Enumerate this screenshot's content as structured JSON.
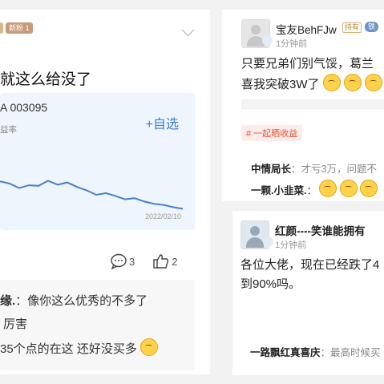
{
  "left_post": {
    "badge": "新粉 1",
    "title": "就这么给没了",
    "fund": {
      "code": "A 003095",
      "sub_label": "益率",
      "add_label": "+自选",
      "date": "2022/02/10"
    },
    "comment_count": "3",
    "like_count": "2",
    "comments": [
      {
        "name": "缘.",
        "text": "：像你这么优秀的不多了"
      },
      {
        "name": "",
        "text": "厉害"
      },
      {
        "name": "",
        "text": "35个点的在这 还好没买多"
      }
    ],
    "chart_data": {
      "type": "line",
      "series": [
        {
          "values": [
            0.54,
            0.5,
            0.42,
            0.47,
            0.46,
            0.55,
            0.48,
            0.52,
            0.44,
            0.38,
            0.3,
            0.33,
            0.28,
            0.22,
            0.24,
            0.18,
            0.14,
            0.12,
            0.08,
            0.05
          ]
        }
      ],
      "x_end_label": "2022/02/10",
      "note": "relative fund return trend (values read as normalized levels)"
    }
  },
  "right_post_1": {
    "username": "宝友BehFJw",
    "tag1": "持有",
    "tag2": "铁",
    "time": "1分钟前",
    "body_line1": "只要兄弟们别气馁，葛兰",
    "body_line2": "喜我突破3W了",
    "topic": "# 一起晒收益",
    "replies": [
      {
        "name": "中情局长",
        "text": "：才亏3万，问题不"
      },
      {
        "name": "一颗.小韭菜.",
        "text": "："
      }
    ]
  },
  "right_post_2": {
    "username": "红颜----笑谁能拥有",
    "time": "1分钟前",
    "body_line1": "各位大佬，现在已经跌了4",
    "body_line2": "到90%吗。",
    "reply": {
      "name": "一路飘红真喜庆",
      "text": "：最高时候买"
    }
  }
}
